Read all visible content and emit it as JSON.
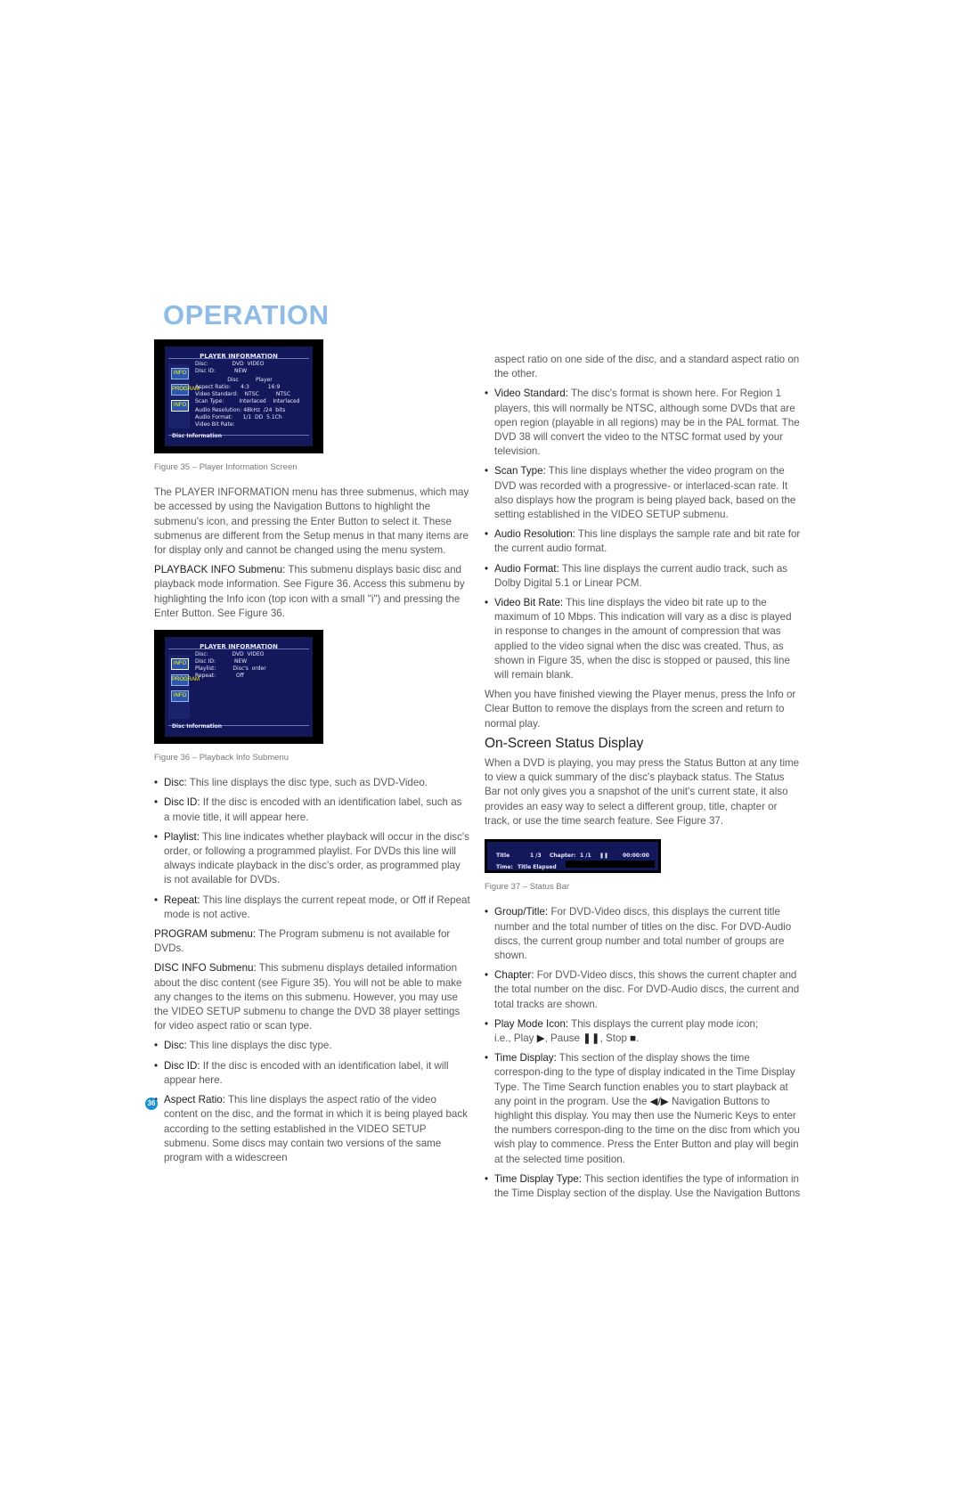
{
  "section_title": "OPERATION",
  "page_number": "36",
  "figure35": {
    "caption": "Figure 35 – Player Information Screen",
    "screen": {
      "title": "PLAYER INFORMATION",
      "icons": [
        "INFO",
        "PROGRAM",
        "INFO"
      ],
      "rows_top": "Disc:              DVD  VIDEO\nDisc ID:           NEW",
      "col_heads": "                   Disc          Player",
      "rows_mid": "Aspect Ratio:      4:3           16:9\nVideo Standard:    NTSC          NTSC\nScan Type:         Interlaced    Interlaced",
      "rows_bottom": "Audio Resolution: 48kHz  /24  bits\nAudio Format:      1/1  DD  5.1Ch\nVideo Bit Rate:",
      "footer": "Disc Information"
    }
  },
  "figure36": {
    "caption": "Figure 36 – Playback Info Submenu",
    "screen": {
      "title": "PLAYER INFORMATION",
      "icons": [
        "INFO",
        "PROGRAM",
        "INFO"
      ],
      "rows": "Disc:              DVD  VIDEO\nDisc ID:           NEW\nPlaylist:          Disc's  order\nRepeat:            Off",
      "footer": "Disc Information"
    }
  },
  "figure37": {
    "caption": "Figure 37 – Status Bar",
    "title_label": "Title",
    "title_value": "1  /3",
    "chapter_label": "Chapter:",
    "chapter_value": "1  /1",
    "pause_glyph": "❚❚",
    "time_value": "00:00:00",
    "time_label": "Time:",
    "time_type": "Title Elapsed"
  },
  "left_col": {
    "intro": "The PLAYER INFORMATION menu has three submenus, which may be accessed by using the Navigation Buttons to highlight the submenu's icon, and pressing the Enter Button to select it. These submenus are different from the Setup menus in that many items are for display only and cannot be changed using the menu system.",
    "playback_label": "PLAYBACK INFO Submenu:",
    "playback_text": " This submenu displays basic disc and playback mode information. See Figure 36. Access this submenu by highlighting the Info icon (top icon with a small \"i\") and pressing the Enter Button. See Figure 36.",
    "bullets1": [
      {
        "label": "Disc:",
        "text": " This line displays the disc type, such as DVD-Video."
      },
      {
        "label": "Disc ID:",
        "text": " If the disc is encoded with an identification label, such as a movie title, it will appear here."
      },
      {
        "label": "Playlist:",
        "text": " This line indicates whether playback will occur in the disc's order, or following a programmed playlist. For DVDs this line will always indicate playback in the disc's order, as programmed play is not available for DVDs."
      },
      {
        "label": "Repeat:",
        "text": " This line displays the current repeat mode, or Off if Repeat mode is not active."
      }
    ],
    "program_label": "PROGRAM submenu:",
    "program_text": " The Program submenu is not available for DVDs.",
    "discinfo_label": "DISC INFO Submenu:",
    "discinfo_text": " This submenu displays detailed information about the disc content (see Figure 35). You will not be able to make any changes to the items on this submenu. However, you may use the VIDEO SETUP submenu to change the DVD 38 player settings for video aspect ratio or scan type.",
    "bullets2": [
      {
        "label": "Disc:",
        "text": " This line displays the disc type."
      },
      {
        "label": "Disc ID:",
        "text": " If the disc is encoded with an identification label, it will appear here."
      },
      {
        "label": "Aspect Ratio:",
        "text": " This line displays the aspect ratio of the video content on the disc, and the format in which it is being played back according to the setting established in the VIDEO SETUP submenu. Some discs may contain two versions of the same program with a widescreen"
      }
    ]
  },
  "right_col": {
    "continuation": "aspect ratio on one side of the disc, and a standard aspect ratio on the other.",
    "bullets1": [
      {
        "label": "Video Standard:",
        "text": " The disc's format is shown here. For Region 1 players, this will normally be NTSC, although some DVDs that are open region (playable in all regions) may be in the PAL format. The DVD 38 will convert the video to the NTSC format used by your television."
      },
      {
        "label": "Scan Type:",
        "text": " This line displays whether the video program on the DVD was recorded with a progressive- or interlaced-scan rate. It also displays how the program is being played back, based on the setting established in the VIDEO SETUP submenu."
      },
      {
        "label": "Audio Resolution:",
        "text": " This line displays the sample rate and bit rate for the current audio format."
      },
      {
        "label": "Audio Format:",
        "text": " This line displays the current audio track, such as Dolby Digital 5.1 or Linear PCM."
      },
      {
        "label": "Video Bit Rate:",
        "text": " This line displays the video bit rate up to the maximum of 10 Mbps. This indication will vary as a disc is played in response to changes in the amount of compression that was applied to the video signal when the disc was created. Thus, as shown in Figure 35, when the disc is stopped or paused, this line will remain blank."
      }
    ],
    "finish_text": "When you have finished viewing the Player menus, press the Info or Clear Button to remove the displays from the screen and return to normal play.",
    "heading": "On-Screen Status Display",
    "status_intro": "When a DVD is playing, you may press the Status Button at any time to view a quick summary of the disc's playback status. The Status Bar not only gives you a snapshot of the unit's current state, it also provides an easy way to select a different group, title, chapter or track, or use the time search feature. See Figure 37.",
    "bullets2": [
      {
        "label": "Group/Title:",
        "text": " For DVD-Video discs, this displays the current title number and the total number of titles on the disc. For DVD-Audio discs, the current group number and total number of groups are shown."
      },
      {
        "label": "Chapter:",
        "text": " For DVD-Video discs, this shows the current chapter and the total number on the disc. For DVD-Audio discs, the current and total tracks are shown."
      }
    ],
    "playmode_label": "Play Mode Icon:",
    "playmode_text1": " This displays the current play mode icon;",
    "playmode_text2": "i.e., Play ",
    "play_glyph": "▶",
    "pause_text": ", Pause ",
    "pause_glyph": "❚❚",
    "stop_text": ", Stop ",
    "stop_glyph": "■",
    "end_text": ".",
    "timedisp_label": "Time Display:",
    "timedisp_text1": " This section of the display shows the time correspon-ding to the type of display indicated in the Time Display Type. The Time Search function enables you to start playback at any point in the program. Use the ",
    "nav_glyph": "◀/▶",
    "timedisp_text2": " Navigation Buttons to highlight this display. You may then use the Numeric Keys to enter the numbers correspon-ding to the time on the disc from which you wish play to commence. Press the Enter Button and play will begin at the selected time position.",
    "timetype_label": "Time Display Type:",
    "timetype_text": " This section identifies the type of information in the Time Display section of the display. Use the Navigation Buttons"
  }
}
